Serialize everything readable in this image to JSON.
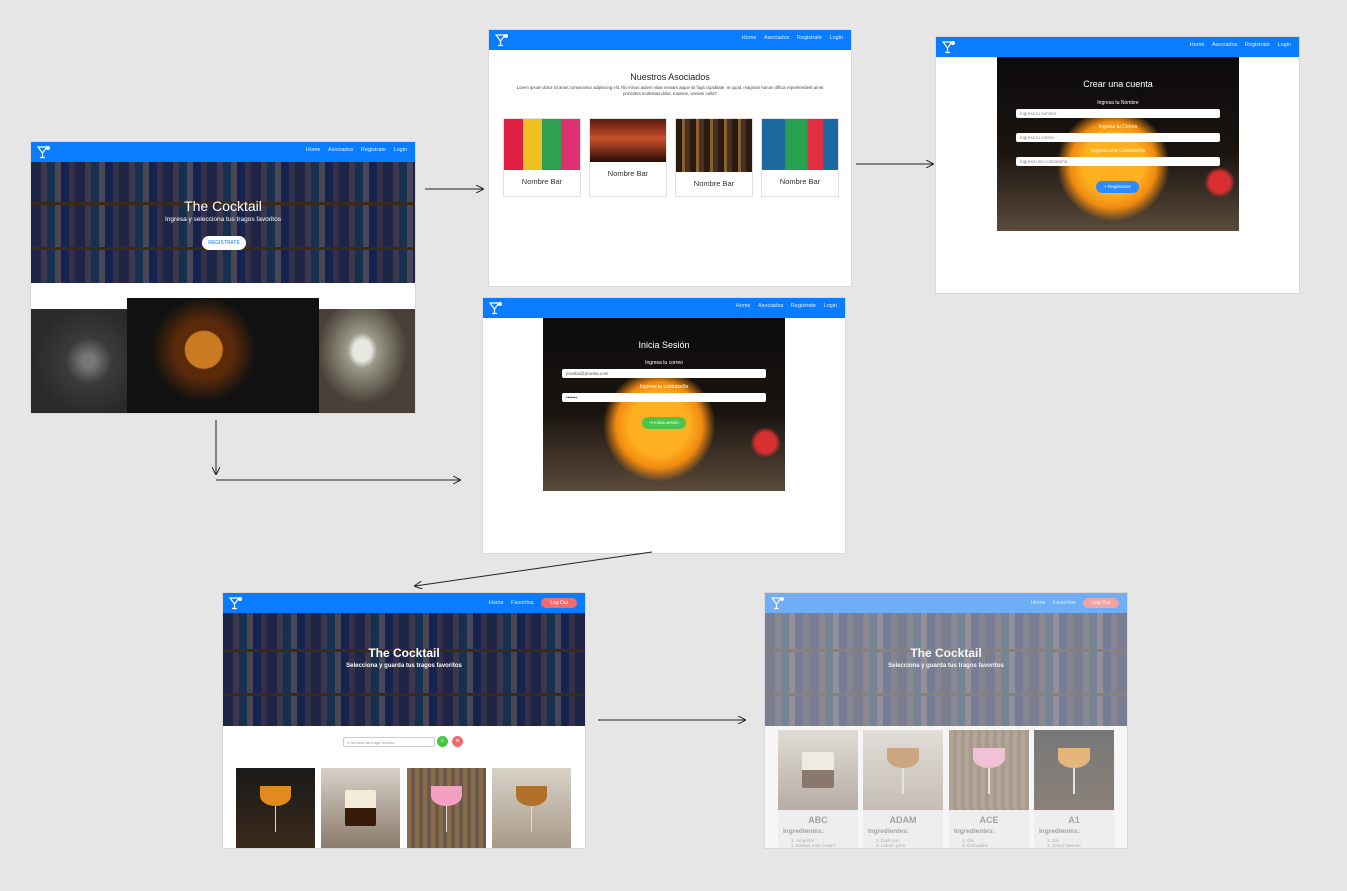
{
  "home": {
    "nav_links": [
      "Home",
      "Asociados",
      "Registrate",
      "Login"
    ],
    "hero_title": "The Cocktail",
    "hero_subtitle": "Ingresa y selecciona tus tragos favoritos",
    "register_button": "REGISTRATE"
  },
  "asociados": {
    "nav_links": [
      "Home",
      "Asociados",
      "Registrate",
      "Login"
    ],
    "title": "Nuestros Asociados",
    "description": "Lorem ipsum dolor sit amet consectetur adipiscing elit. Illo minus autem vitae veniam atque sit fugit cupiditate. In quod, magnam harum officia reprehenderit amet provident molestias dolor, maxime, veniam nulla?",
    "bars": [
      "Nombre Bar",
      "Nombre Bar",
      "Nombre Bar",
      "Nombre Bar"
    ]
  },
  "registro": {
    "nav_links": [
      "Home",
      "Asociados",
      "Registrate",
      "Login"
    ],
    "title": "Crear una cuenta",
    "name_label": "Ingresa tu Nombre",
    "name_placeholder": "Ingresa tu nombre",
    "email_label": "Ingresa tu Correo",
    "email_placeholder": "Ingresa tu correo",
    "password_label": "Ingresa una Contraseña",
    "password_placeholder": "Ingresa una contraseña",
    "submit_button": "+ Registrarse"
  },
  "login": {
    "nav_links": [
      "Home",
      "Asociados",
      "Registrate",
      "Login"
    ],
    "title": "Inicia Sesión",
    "email_label": "Ingresa tu correo",
    "email_value": "prueba@prueba.com",
    "password_label": "Ingresa tu contraseña",
    "password_value": "•••••••",
    "submit_button": "⇥ Inicia sesión"
  },
  "dashboard": {
    "nav_links": [
      "Home",
      "Favoritos"
    ],
    "logout_button": "Log Out",
    "hero_title": "The Cocktail",
    "hero_subtitle": "Selecciona y guarda tus tragos favoritos",
    "search_placeholder": "Nombre de trago favorito"
  },
  "favoritos": {
    "nav_links": [
      "Home",
      "Favoritos"
    ],
    "logout_button": "Log Out",
    "hero_title": "The Cocktail",
    "hero_subtitle": "Selecciona y guarda tus tragos favoritos",
    "ingredients_label": "Ingredientes:",
    "drinks": [
      {
        "name": "ABC",
        "ingredients": [
          "Amaretto",
          "Baileys Irish Cream"
        ]
      },
      {
        "name": "ADAM",
        "ingredients": [
          "Dark rum",
          "Lemon juice"
        ]
      },
      {
        "name": "ACE",
        "ingredients": [
          "Gin",
          "Grenadine"
        ]
      },
      {
        "name": "A1",
        "ingredients": [
          "Gin",
          "Grand Marnier"
        ]
      }
    ]
  },
  "colors": {
    "nav": "#0a7cff",
    "canvas": "#e6e6e6",
    "logout": "#f26b6b",
    "green": "#4cc34c",
    "red": "#f26b6b"
  },
  "icons": [
    "cocktail-logo-icon",
    "search-icon",
    "plus-icon",
    "login-icon"
  ]
}
